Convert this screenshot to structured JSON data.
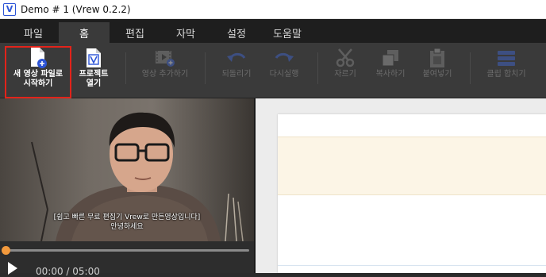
{
  "window": {
    "title": "Demo # 1 (Vrew 0.2.2)",
    "logo_letter": "V"
  },
  "menu": {
    "tabs": [
      {
        "label": "파일",
        "active": false
      },
      {
        "label": "홈",
        "active": true
      },
      {
        "label": "편집",
        "active": false
      },
      {
        "label": "자막",
        "active": false
      },
      {
        "label": "설정",
        "active": false
      },
      {
        "label": "도움말",
        "active": false
      }
    ]
  },
  "toolbar": {
    "new_project": "새 영상 파일로\n시작하기",
    "open_project": "프로젝트\n열기",
    "add_video": "영상 추가하기",
    "undo": "되돌리기",
    "redo": "다시실행",
    "cut": "자르기",
    "copy": "복사하기",
    "paste": "붙여넣기",
    "merge_clips": "클립 합치기"
  },
  "colors": {
    "accent": "#2d55d7",
    "highlight": "#e2231a",
    "progress_knob": "#f39a3d"
  },
  "video": {
    "subtitle_line1": "[쉽고 빠른 무료 편집기 Vrew로 만든영상입니다]",
    "subtitle_line2": "안녕하세요",
    "time": "00:00 / 05:00",
    "progress": 0
  }
}
